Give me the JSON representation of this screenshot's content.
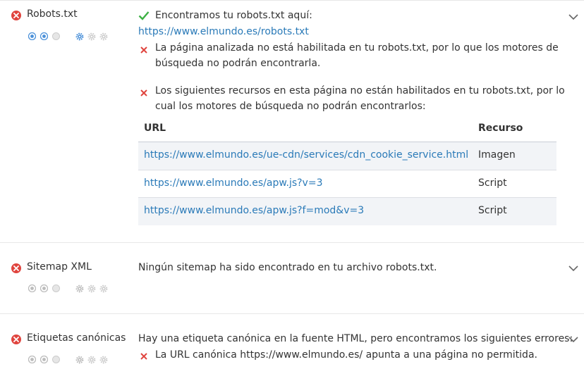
{
  "colors": {
    "error": "#e0443e",
    "ok": "#3cb043",
    "link": "#2a7ab8",
    "rating_active": "#4a90d9",
    "rating_inactive": "#cccccc",
    "table_alt_row": "#f2f4f7"
  },
  "sections": [
    {
      "title": "Robots.txt",
      "status_icon": "error-circle-icon",
      "rating": {
        "dots_active": 2,
        "dots_total": 3,
        "gears_active": 1,
        "gears_total": 3
      },
      "success_text": "Encontramos tu robots.txt aquí:",
      "success_link": "https://www.elmundo.es/robots.txt",
      "error1_line1": "La página analizada no está habilitada en tu robots.txt, por lo que los motores de",
      "error1_line2": "búsqueda no podrán encontrarla.",
      "error2_line1": "Los siguientes recursos en esta página no están habilitados en tu robots.txt, por lo",
      "error2_line2": "cual los motores de búsqueda no podrán encontrarlos:",
      "table": {
        "headers": [
          "URL",
          "Recurso"
        ],
        "rows": [
          {
            "url": "https://www.elmundo.es/ue-cdn/services/cdn_cookie_service.html",
            "type": "Imagen"
          },
          {
            "url": "https://www.elmundo.es/apw.js?v=3",
            "type": "Script"
          },
          {
            "url": "https://www.elmundo.es/apw.js?f=mod&v=3",
            "type": "Script"
          }
        ]
      }
    },
    {
      "title": "Sitemap XML",
      "status_icon": "error-circle-icon",
      "rating": {
        "dots_active": 0,
        "dots_total": 3,
        "gears_active": 0,
        "gears_total": 3
      },
      "message": "Ningún sitemap ha sido encontrado en tu archivo robots.txt."
    },
    {
      "title": "Etiquetas canónicas",
      "status_icon": "error-circle-icon",
      "rating": {
        "dots_active": 0,
        "dots_total": 3,
        "gears_active": 0,
        "gears_total": 3
      },
      "message": "Hay una etiqueta canónica en la fuente HTML, pero encontramos los siguientes errores:",
      "error_text": "La URL canónica https://www.elmundo.es/ apunta a una página no permitida."
    }
  ]
}
